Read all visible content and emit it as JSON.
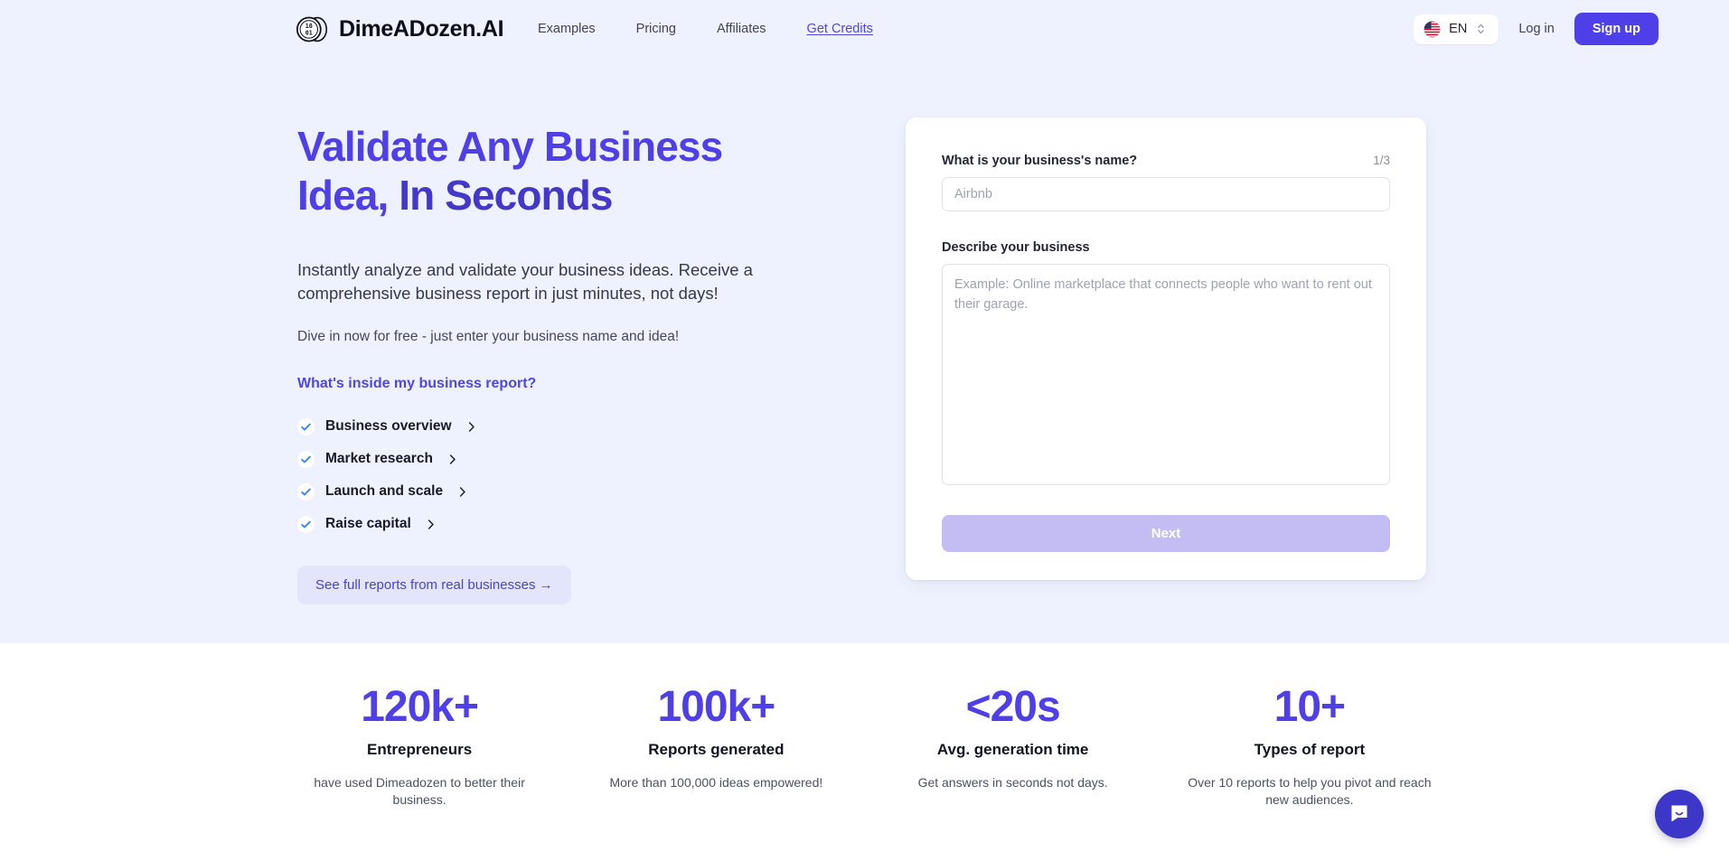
{
  "header": {
    "brand_name": "DimeADozen.AI",
    "logo_icon": "coin-binary-icon",
    "nav": [
      {
        "label": "Examples",
        "accent": false
      },
      {
        "label": "Pricing",
        "accent": false
      },
      {
        "label": "Affiliates",
        "accent": false
      },
      {
        "label": "Get Credits",
        "accent": true
      }
    ],
    "language": {
      "code": "EN",
      "flag_icon": "us-flag-icon",
      "chevron_icon": "up-down-chevron-icon"
    },
    "login_label": "Log in",
    "signup_label": "Sign up"
  },
  "hero": {
    "headline_line1": "Validate Any Business",
    "headline_line2_normal": "Idea, ",
    "headline_line2_bold": "In Seconds",
    "subheading": "Instantly analyze and validate your business ideas. Receive a comprehensive business report in just minutes, not days!",
    "dive_in": "Dive in now for free - just enter your business name and idea!",
    "inside_title": "What's inside my business report?",
    "checklist": [
      {
        "label": "Business overview"
      },
      {
        "label": "Market research"
      },
      {
        "label": "Launch and scale"
      },
      {
        "label": "Raise capital"
      }
    ],
    "reports_button": "See full reports from real businesses  →"
  },
  "form": {
    "name_label": "What is your business's name?",
    "step_counter": "1/3",
    "name_value": "",
    "name_placeholder": "Airbnb",
    "describe_label": "Describe your business",
    "describe_value": "",
    "describe_placeholder": "Example: Online marketplace that connects people who want to rent out their garage.",
    "next_label": "Next"
  },
  "stats": [
    {
      "value": "120k+",
      "title": "Entrepreneurs",
      "desc": "have used Dimeadozen to better their business."
    },
    {
      "value": "100k+",
      "title": "Reports generated",
      "desc": "More than 100,000 ideas empowered!"
    },
    {
      "value": "<20s",
      "title": "Avg. generation time",
      "desc": "Get answers in seconds not days."
    },
    {
      "value": "10+",
      "title": "Types of report",
      "desc": "Over 10 reports to help you pivot and reach new audiences."
    }
  ],
  "chat": {
    "icon": "chat-bubble-icon"
  },
  "colors": {
    "hero_bg": "#eef1fe",
    "brand_purple": "#4f3fe8",
    "accent_link": "#4f46e5",
    "check_blue": "#3b82f6",
    "next_disabled": "#c3bdf3",
    "chat_bg": "#3c36c9"
  }
}
